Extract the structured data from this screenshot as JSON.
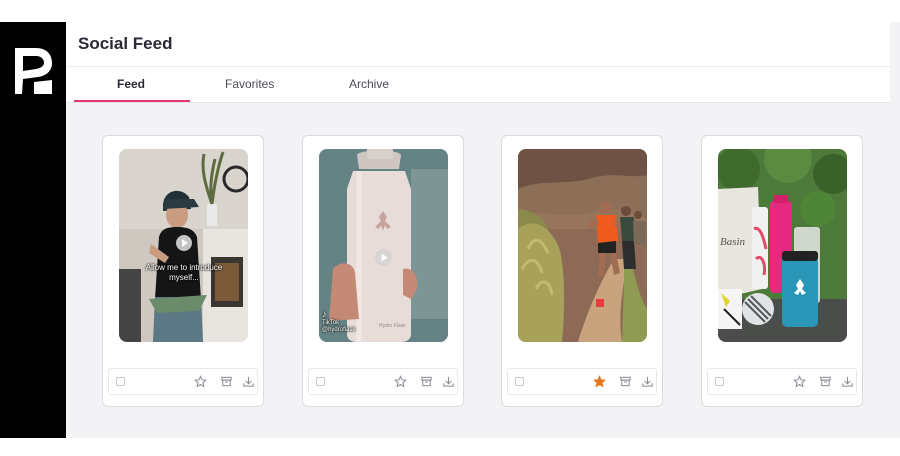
{
  "app": {
    "title": "Social Feed",
    "logo_icon": "brand-r-logo-icon"
  },
  "tabs": [
    {
      "label": "Feed",
      "active": true
    },
    {
      "label": "Favorites",
      "active": false
    },
    {
      "label": "Archive",
      "active": false
    }
  ],
  "colors": {
    "accent": "#e6356f",
    "favorite_active": "#e8761c",
    "icon": "#8a8a94",
    "sidebar": "#000000"
  },
  "cards": [
    {
      "media": "video",
      "caption_line1": "Allow me to introduce",
      "caption_line2": "myself...",
      "favorite": false,
      "icons": [
        "checkbox-icon",
        "star-icon",
        "archive-icon",
        "download-icon"
      ]
    },
    {
      "media": "video",
      "source_label": "TikTok",
      "source_handle": "@hydroflask",
      "bottle_label": "Hydro Flask",
      "favorite": false,
      "icons": [
        "checkbox-icon",
        "star-icon",
        "archive-icon",
        "download-icon"
      ]
    },
    {
      "media": "image",
      "favorite": true,
      "icons": [
        "checkbox-icon",
        "star-filled-icon",
        "archive-icon",
        "download-icon"
      ]
    },
    {
      "media": "image",
      "bag_label": "Basin",
      "favorite": false,
      "icons": [
        "checkbox-icon",
        "star-icon",
        "archive-icon",
        "download-icon"
      ]
    }
  ]
}
